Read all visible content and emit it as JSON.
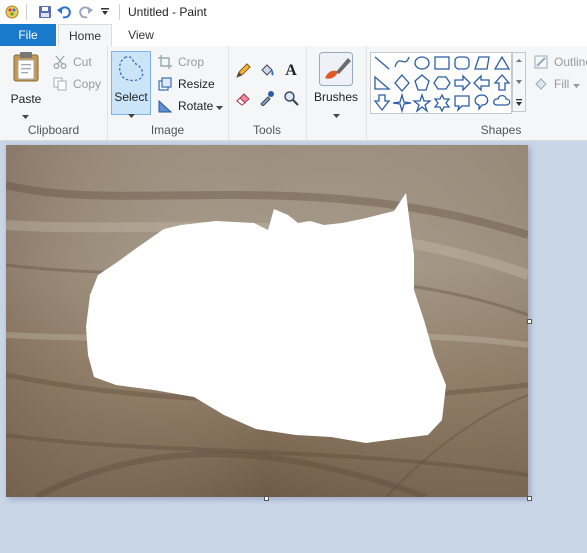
{
  "window": {
    "title": "Untitled - Paint"
  },
  "quick_access": {
    "icons": [
      "paint-app-icon",
      "save-icon",
      "undo-icon",
      "redo-icon",
      "customize-dropdown-icon"
    ]
  },
  "tabs": {
    "file": "File",
    "home": "Home",
    "view": "View"
  },
  "clipboard": {
    "paste": "Paste",
    "cut": "Cut",
    "copy": "Copy",
    "label": "Clipboard"
  },
  "image": {
    "select": "Select",
    "crop": "Crop",
    "resize": "Resize",
    "rotate": "Rotate",
    "label": "Image"
  },
  "tools": {
    "label": "Tools",
    "icons": [
      "pencil-icon",
      "fill-bucket-icon",
      "text-icon",
      "eraser-icon",
      "color-picker-icon",
      "magnifier-icon"
    ]
  },
  "brushes": {
    "label": "Brushes"
  },
  "shapes": {
    "label": "Shapes",
    "outline": "Outline",
    "fill": "Fill",
    "items": [
      "line",
      "curve",
      "oval",
      "rectangle",
      "rounded-rectangle",
      "polygon",
      "triangle",
      "right-triangle",
      "diamond",
      "pentagon",
      "hexagon",
      "right-arrow",
      "left-arrow",
      "up-arrow",
      "down-arrow",
      "four-point-star",
      "five-point-star",
      "six-point-star",
      "rounded-callout",
      "oval-callout",
      "cloud-callout"
    ]
  },
  "colors": {
    "file_tab": "#1979ca",
    "workspace": "#c9d6e8",
    "ribbon": "#f5f6f7",
    "wood_light": "#a8977f",
    "wood_dark": "#5a4838",
    "selection_fill": "#ffffff"
  }
}
